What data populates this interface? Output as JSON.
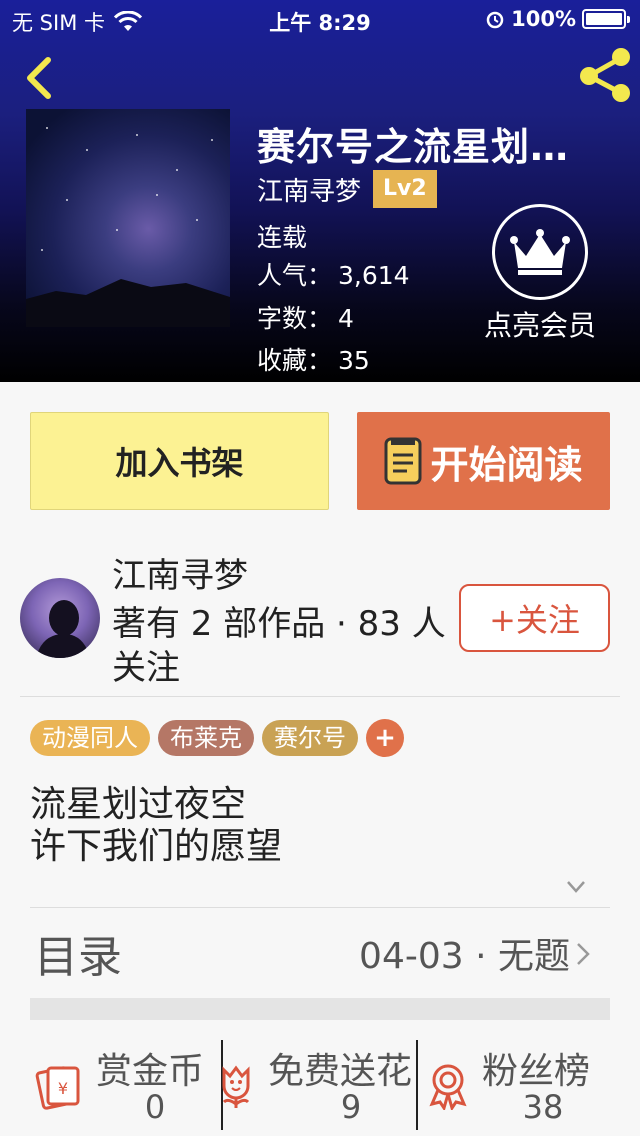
{
  "status_bar": {
    "carrier": "无 SIM 卡",
    "time": "上午 8:29",
    "battery": "100%"
  },
  "book": {
    "title": "赛尔号之流星划过夜空",
    "author": "江南寻梦",
    "level": "Lv2",
    "state": "连载",
    "popularity_label": "人气：",
    "popularity": "3,614",
    "words_label": "字数：",
    "words": "4",
    "favorites_label": "收藏：",
    "favorites": "35"
  },
  "vip": {
    "label": "点亮会员"
  },
  "actions": {
    "add_shelf": "加入书架",
    "start_reading": "开始阅读"
  },
  "author": {
    "name": "江南寻梦",
    "works_desc": "著有 2 部作品 · 83 人关注",
    "follow_label": "+关注"
  },
  "tags": [
    {
      "label": "动漫同人",
      "color": "#eab455"
    },
    {
      "label": "布莱克",
      "color": "#b57766"
    },
    {
      "label": "赛尔号",
      "color": "#c9a254"
    }
  ],
  "tag_add_label": "+",
  "description": {
    "line1": "流星划过夜空",
    "line2": "许下我们的愿望"
  },
  "toc": {
    "title": "目录",
    "latest": "04-03 · 无题"
  },
  "stats": {
    "reward": {
      "label": "赏金币",
      "value": "0"
    },
    "flowers": {
      "label": "免费送花",
      "value": "9"
    },
    "fans": {
      "label": "粉丝榜",
      "value": "38"
    }
  },
  "colors": {
    "accent_orange": "#e0714a",
    "shelf_yellow": "#fcf293",
    "follow_red": "#d9553e",
    "lv_gold": "#e6b452"
  }
}
